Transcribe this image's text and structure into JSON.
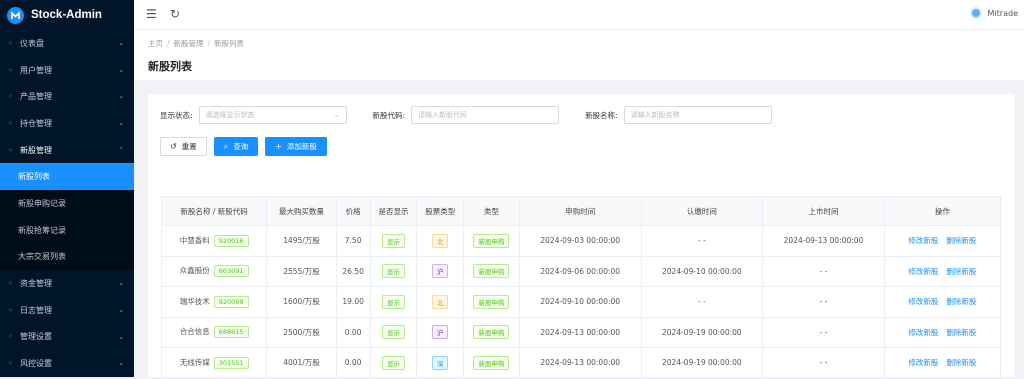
{
  "brand": {
    "title": "Stock-Admin"
  },
  "sidebar": {
    "items": [
      {
        "label": "仪表盘",
        "icon": "dashboard-icon"
      },
      {
        "label": "用户管理",
        "icon": "users-icon"
      },
      {
        "label": "产品管理",
        "icon": "product-icon"
      },
      {
        "label": "持仓管理",
        "icon": "holdings-icon"
      },
      {
        "label": "新股管理",
        "icon": "ipo-icon"
      }
    ],
    "sub_items": [
      {
        "label": "新股列表"
      },
      {
        "label": "新股申购记录"
      },
      {
        "label": "新股抢筹记录"
      },
      {
        "label": "大宗交易列表"
      }
    ],
    "items_after": [
      {
        "label": "资金管理",
        "icon": "funds-icon"
      },
      {
        "label": "日志管理",
        "icon": "log-icon"
      },
      {
        "label": "管理设置",
        "icon": "admin-settings-icon"
      },
      {
        "label": "风控设置",
        "icon": "risk-icon"
      }
    ]
  },
  "topbar": {
    "user": "Mitrade"
  },
  "breadcrumb": {
    "home": "主页",
    "level1": "新股管理",
    "level2": "新股列表"
  },
  "page": {
    "title": "新股列表"
  },
  "filters": {
    "status_label": "显示状态:",
    "status_placeholder": "请选择显示状态",
    "code_label": "新股代码:",
    "code_placeholder": "请输入新股代码",
    "name_label": "新股名称:",
    "name_placeholder": "请输入新股名称"
  },
  "buttons": {
    "reset": "重置",
    "search": "查询",
    "add": "添加新股"
  },
  "table": {
    "headers": [
      "新股名称 / 新股代码",
      "最大购买数量",
      "价格",
      "是否显示",
      "股票类型",
      "类型",
      "申购时间",
      "认缴时间",
      "上市时间",
      "操作"
    ],
    "rows": [
      {
        "name": "中慧香料",
        "code": "920016",
        "max": "1495/万股",
        "price": "7.50",
        "show": "显示",
        "stype": "北",
        "stype_color": "orange",
        "type": "新股申购",
        "apply": "2024-09-03 00:00:00",
        "subscribe": "- -",
        "listing": "2024-09-13 00:00:00",
        "edit": "修改新股",
        "del": "删除新股"
      },
      {
        "name": "众鑫股份",
        "code": "603091",
        "max": "2555/万股",
        "price": "26.50",
        "show": "显示",
        "stype": "沪",
        "stype_color": "purple",
        "type": "新股申购",
        "apply": "2024-09-06 00:00:00",
        "subscribe": "2024-09-10 00:00:00",
        "listing": "- -",
        "edit": "修改新股",
        "del": "删除新股"
      },
      {
        "name": "瑞华技术",
        "code": "920099",
        "max": "1600/万股",
        "price": "19.00",
        "show": "显示",
        "stype": "北",
        "stype_color": "orange",
        "type": "新股申购",
        "apply": "2024-09-10 00:00:00",
        "subscribe": "- -",
        "listing": "- -",
        "edit": "修改新股",
        "del": "删除新股"
      },
      {
        "name": "合合信息",
        "code": "688615",
        "max": "2500/万股",
        "price": "0.00",
        "show": "显示",
        "stype": "沪",
        "stype_color": "purple",
        "type": "新股申购",
        "apply": "2024-09-13 00:00:00",
        "subscribe": "2024-09-19 00:00:00",
        "listing": "- -",
        "edit": "修改新股",
        "del": "删除新股"
      },
      {
        "name": "无线传媒",
        "code": "301551",
        "max": "4001/万股",
        "price": "0.00",
        "show": "显示",
        "stype": "深",
        "stype_color": "blue",
        "type": "新股申购",
        "apply": "2024-09-13 00:00:00",
        "subscribe": "2024-09-19 00:00:00",
        "listing": "- -",
        "edit": "修改新股",
        "del": "删除新股"
      }
    ]
  }
}
